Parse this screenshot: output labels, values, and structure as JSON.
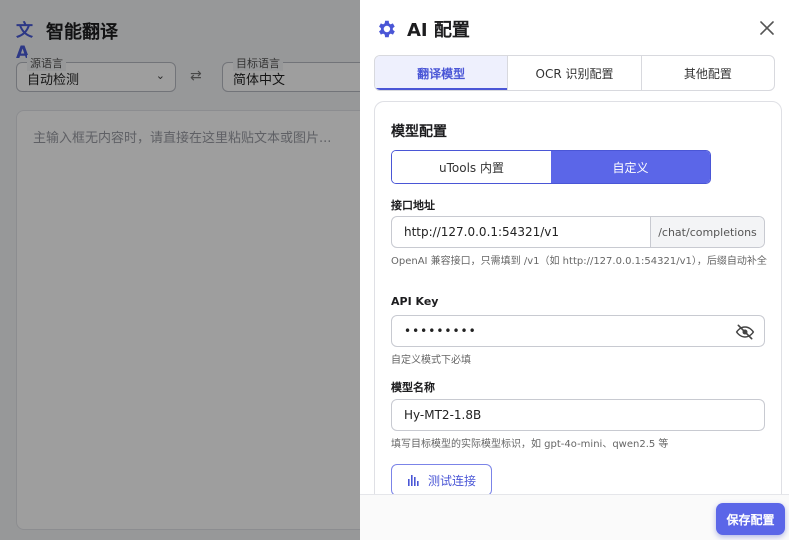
{
  "app": {
    "title": "智能翻译",
    "source_lang": {
      "legend": "源语言",
      "value": "自动检测"
    },
    "target_lang": {
      "legend": "目标语言",
      "value": "简体中文"
    },
    "input_placeholder": "主输入框无内容时，请直接在这里粘贴文本或图片..."
  },
  "drawer": {
    "title": "AI 配置",
    "tabs": [
      {
        "label": "翻译模型",
        "active": true
      },
      {
        "label": "OCR 识别配置",
        "active": false
      },
      {
        "label": "其他配置",
        "active": false
      }
    ],
    "section_title": "模型配置",
    "mode_options": [
      {
        "label": "uTools 内置",
        "active": false
      },
      {
        "label": "自定义",
        "active": true
      }
    ],
    "endpoint": {
      "label": "接口地址",
      "value": "http://127.0.0.1:54321/v1",
      "suffix": "/chat/completions",
      "help": "OpenAI 兼容接口，只需填到 /v1（如 http://127.0.0.1:54321/v1），后缀自动补全"
    },
    "api_key": {
      "label": "API Key",
      "value": "•••••••••",
      "help": "自定义模式下必填"
    },
    "model_name": {
      "label": "模型名称",
      "value": "Hy-MT2-1.8B",
      "help": "填写目标模型的实际模型标识，如 gpt-4o-mini、qwen2.5 等"
    },
    "test_button": "测试连接",
    "save_button": "保存配置"
  },
  "colors": {
    "accent": "#5b66e8",
    "accent_dark": "#4a56d6"
  }
}
